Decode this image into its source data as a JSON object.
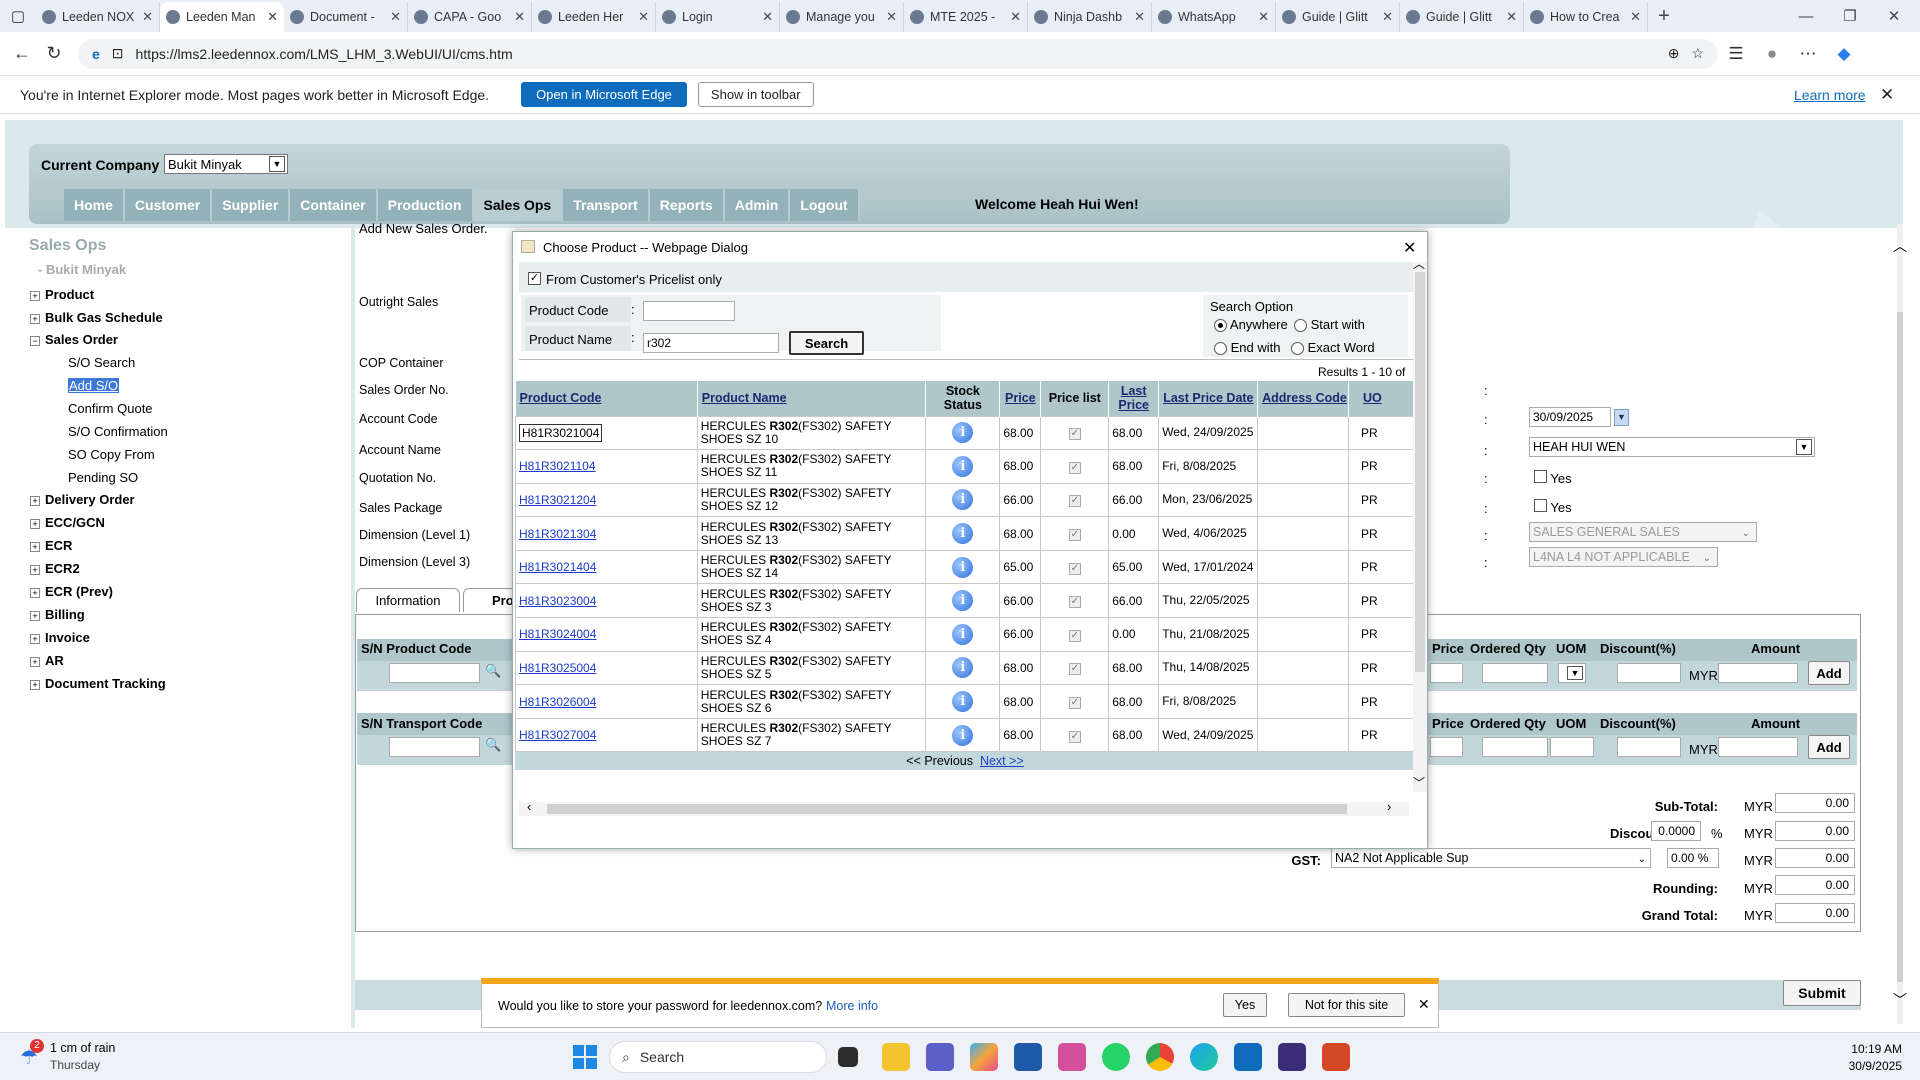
{
  "browser": {
    "tabs": [
      {
        "title": "Leeden NOX",
        "icon": "globe-icon"
      },
      {
        "title": "Leeden Man",
        "icon": "ie-icon",
        "active": true
      },
      {
        "title": "Document -",
        "icon": "edge-doc-icon"
      },
      {
        "title": "CAPA - Goo",
        "icon": "google-icon"
      },
      {
        "title": "Leeden Her",
        "icon": "map-pin-icon"
      },
      {
        "title": "Login",
        "icon": "gmail-icon"
      },
      {
        "title": "Manage you",
        "icon": "app-icon"
      },
      {
        "title": "MTE 2025 -",
        "icon": "globe-icon"
      },
      {
        "title": "Ninja Dashb",
        "icon": "ninja-icon"
      },
      {
        "title": "WhatsApp",
        "icon": "whatsapp-icon"
      },
      {
        "title": "Guide | Glitt",
        "icon": "google-icon"
      },
      {
        "title": "Guide | Glitt",
        "icon": "google-icon"
      },
      {
        "title": "How to Crea",
        "icon": "google-icon"
      }
    ],
    "url": "https://lms2.leedennox.com/LMS_LHM_3.WebUI/UI/cms.htm",
    "ie_mode": {
      "message": "You're in Internet Explorer mode. Most pages work better in Microsoft Edge.",
      "open_button": "Open in Microsoft Edge",
      "toolbar_button": "Show in toolbar",
      "learn_more": "Learn more"
    }
  },
  "app": {
    "current_company_label": "Current Company :",
    "current_company": "Bukit Minyak",
    "nav": [
      "Home",
      "Customer",
      "Supplier",
      "Container",
      "Production",
      "Sales Ops",
      "Transport",
      "Reports",
      "Admin",
      "Logout"
    ],
    "active_nav": "Sales Ops",
    "welcome": "Welcome Heah Hui Wen!"
  },
  "sidebar": {
    "title": "Sales Ops",
    "subtitle": "- Bukit Minyak",
    "groups": [
      "Product",
      "Bulk Gas Schedule"
    ],
    "sales_order": "Sales Order",
    "sales_order_items": [
      "S/O Search",
      "Add S/O",
      "Confirm Quote",
      "S/O Confirmation",
      "SO Copy From",
      "Pending SO"
    ],
    "more_groups": [
      "Delivery Order",
      "ECC/GCN",
      "ECR",
      "ECR2",
      "ECR (Prev)",
      "Billing",
      "Invoice",
      "AR",
      "Document Tracking"
    ]
  },
  "form": {
    "heading": "Add New Sales Order.",
    "labels": [
      "Outright Sales",
      "COP Container",
      "Sales Order No.",
      "Account Code",
      "Account Name",
      "Quotation No.",
      "Sales Package",
      "Dimension (Level 1)",
      "Dimension (Level 3)"
    ],
    "date": "30/09/2025",
    "salesperson": "HEAH HUI WEN",
    "yes1": "Yes",
    "yes2": "Yes",
    "dimension1": "SALES GENERAL SALES",
    "dimension3": "L4NA L4 NOT APPLICABLE",
    "tabs": [
      "Information",
      "Pro"
    ],
    "grid1_cols": {
      "sn_product_code": "S/N Product Code",
      "price": "Price",
      "ordered_qty": "Ordered Qty",
      "uom": "UOM",
      "discount": "Discount(%)",
      "amount": "Amount"
    },
    "grid2_cols": {
      "sn_transport_code": "S/N Transport Code",
      "price": "Price",
      "ordered_qty": "Ordered Qty",
      "uom": "UOM",
      "discount": "Discount(%)",
      "amount": "Amount"
    },
    "currency": "MYR",
    "add": "Add",
    "totals": {
      "subtotal_label": "Sub-Total:",
      "subtotal": "0.00",
      "discount_label": "Discount:",
      "discount_pct": "0.0000",
      "pct": "%",
      "discount": "0.00",
      "gst_label": "GST:",
      "gst_code": "NA2 Not Applicable Sup",
      "gst_pct": "0.00 %",
      "gst": "0.00",
      "rounding_label": "Rounding:",
      "rounding": "0.00",
      "grand_label": "Grand Total:",
      "grand": "0.00"
    },
    "submit": "Submit"
  },
  "dialog": {
    "title": "Choose Product -- Webpage Dialog",
    "pricelist_only": "From Customer's Pricelist only",
    "product_code_label": "Product Code",
    "product_code": "",
    "product_name_label": "Product Name",
    "product_name": "r302",
    "search_button": "Search",
    "search_option_label": "Search Option",
    "options": {
      "anywhere": "Anywhere",
      "start_with": "Start with",
      "end_with": "End with",
      "exact_word": "Exact Word"
    },
    "results_text": "Results 1 - 10 of",
    "columns": {
      "code": "Product Code",
      "name": "Product Name",
      "stock": "Stock Status",
      "price": "Price",
      "pricelist": "Price list",
      "last_price": "Last Price",
      "last_date": "Last Price Date",
      "address": "Address Code",
      "uom": "UO"
    },
    "rows": [
      {
        "code": "H81R3021004",
        "name_pre": "HERCULES ",
        "name_bold": "R302",
        "name_post": "(FS302) SAFETY SHOES SZ 10",
        "price": "68.00",
        "last_price": "68.00",
        "last_date": "Wed, 24/09/2025",
        "uom": "PR"
      },
      {
        "code": "H81R3021104",
        "name_pre": "HERCULES ",
        "name_bold": "R302",
        "name_post": "(FS302) SAFETY SHOES SZ 11",
        "price": "68.00",
        "last_price": "68.00",
        "last_date": "Fri, 8/08/2025",
        "uom": "PR"
      },
      {
        "code": "H81R3021204",
        "name_pre": "HERCULES ",
        "name_bold": "R302",
        "name_post": "(FS302) SAFETY SHOES SZ 12",
        "price": "66.00",
        "last_price": "66.00",
        "last_date": "Mon, 23/06/2025",
        "uom": "PR"
      },
      {
        "code": "H81R3021304",
        "name_pre": "HERCULES ",
        "name_bold": "R302",
        "name_post": "(FS302) SAFETY SHOES SZ 13",
        "price": "68.00",
        "last_price": "0.00",
        "last_date": "Wed, 4/06/2025",
        "uom": "PR"
      },
      {
        "code": "H81R3021404",
        "name_pre": "HERCULES ",
        "name_bold": "R302",
        "name_post": "(FS302) SAFETY SHOES SZ 14",
        "price": "65.00",
        "last_price": "65.00",
        "last_date": "Wed, 17/01/2024",
        "uom": "PR"
      },
      {
        "code": "H81R3023004",
        "name_pre": "HERCULES ",
        "name_bold": "R302",
        "name_post": "(FS302) SAFETY SHOES SZ 3",
        "price": "66.00",
        "last_price": "66.00",
        "last_date": "Thu, 22/05/2025",
        "uom": "PR"
      },
      {
        "code": "H81R3024004",
        "name_pre": "HERCULES ",
        "name_bold": "R302",
        "name_post": "(FS302) SAFETY SHOES SZ 4",
        "price": "66.00",
        "last_price": "0.00",
        "last_date": "Thu, 21/08/2025",
        "uom": "PR"
      },
      {
        "code": "H81R3025004",
        "name_pre": "HERCULES ",
        "name_bold": "R302",
        "name_post": "(FS302) SAFETY SHOES SZ 5",
        "price": "68.00",
        "last_price": "68.00",
        "last_date": "Thu, 14/08/2025",
        "uom": "PR"
      },
      {
        "code": "H81R3026004",
        "name_pre": "HERCULES ",
        "name_bold": "R302",
        "name_post": "(FS302) SAFETY SHOES SZ 6",
        "price": "68.00",
        "last_price": "68.00",
        "last_date": "Fri, 8/08/2025",
        "uom": "PR"
      },
      {
        "code": "H81R3027004",
        "name_pre": "HERCULES ",
        "name_bold": "R302",
        "name_post": "(FS302) SAFETY SHOES SZ 7",
        "price": "68.00",
        "last_price": "68.00",
        "last_date": "Wed, 24/09/2025",
        "uom": "PR"
      }
    ],
    "prev": "<< Previous",
    "next": "Next >>"
  },
  "password_prompt": {
    "text": "Would you like to store your password for leedennox.com?",
    "more_info": "More info",
    "yes": "Yes",
    "no": "Not for this site"
  },
  "taskbar": {
    "weather_badge": "2",
    "weather": "1 cm of rain",
    "weather_day": "Thursday",
    "search": "Search",
    "time": "10:19 AM",
    "date": "30/9/2025"
  },
  "colors": {
    "nav_bg": "#93b1b8",
    "page_bg": "#dce9ec",
    "grid_header": "#afc6cb",
    "link": "#1a3cc8",
    "edge_blue": "#0f6cbd",
    "password_bar": "#f2a516"
  }
}
